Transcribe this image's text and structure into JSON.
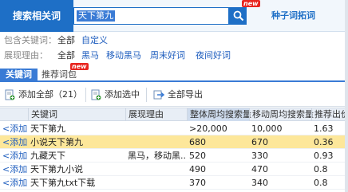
{
  "header": {
    "label": "搜索相关词",
    "search_value": "天下第九",
    "new_badge": "new",
    "seed_tool": "种子词拓词"
  },
  "filters": {
    "include_title": "包含关键词：",
    "include_options": [
      "全部",
      "自定义"
    ],
    "reason_title": "展现理由：",
    "reason_options": [
      "全部",
      "黑马",
      "移动黑马",
      "周末好词",
      "夜间好词"
    ]
  },
  "tabs": [
    {
      "label": "关键词",
      "active": true
    },
    {
      "label": "推荐词包",
      "active": false
    }
  ],
  "tab_new_badge": "new",
  "toolbar": {
    "add_all": "添加全部（21）",
    "add_selected": "添加选中",
    "export_all": "全部导出"
  },
  "table": {
    "columns": [
      "关键词",
      "展现理由",
      "整体周均搜索量",
      "移动周均搜索量",
      "推荐出价"
    ],
    "rows": [
      {
        "action": "<添加",
        "keyword": "天下第九",
        "reason": "",
        "total": ">20,000",
        "mobile": "10,000",
        "bid": "1.63"
      },
      {
        "action": "<添加",
        "keyword": "小说天下第九",
        "reason": "",
        "total": "680",
        "mobile": "670",
        "bid": "0.36"
      },
      {
        "action": "<添加",
        "keyword": "九藏天下",
        "reason": "黑马，移动黑...",
        "total": "520",
        "mobile": "330",
        "bid": "0.93"
      },
      {
        "action": "<添加",
        "keyword": "天下第九小说",
        "reason": "",
        "total": "490",
        "mobile": "470",
        "bid": "0.8"
      },
      {
        "action": "<添加",
        "keyword": "天下第九txt下载",
        "reason": "",
        "total": "370",
        "mobile": "340",
        "bid": "0.8"
      }
    ]
  },
  "colors": {
    "accent": "#1e6fc6",
    "highlight_row": "#fde79a",
    "badge": "#e8251f"
  }
}
